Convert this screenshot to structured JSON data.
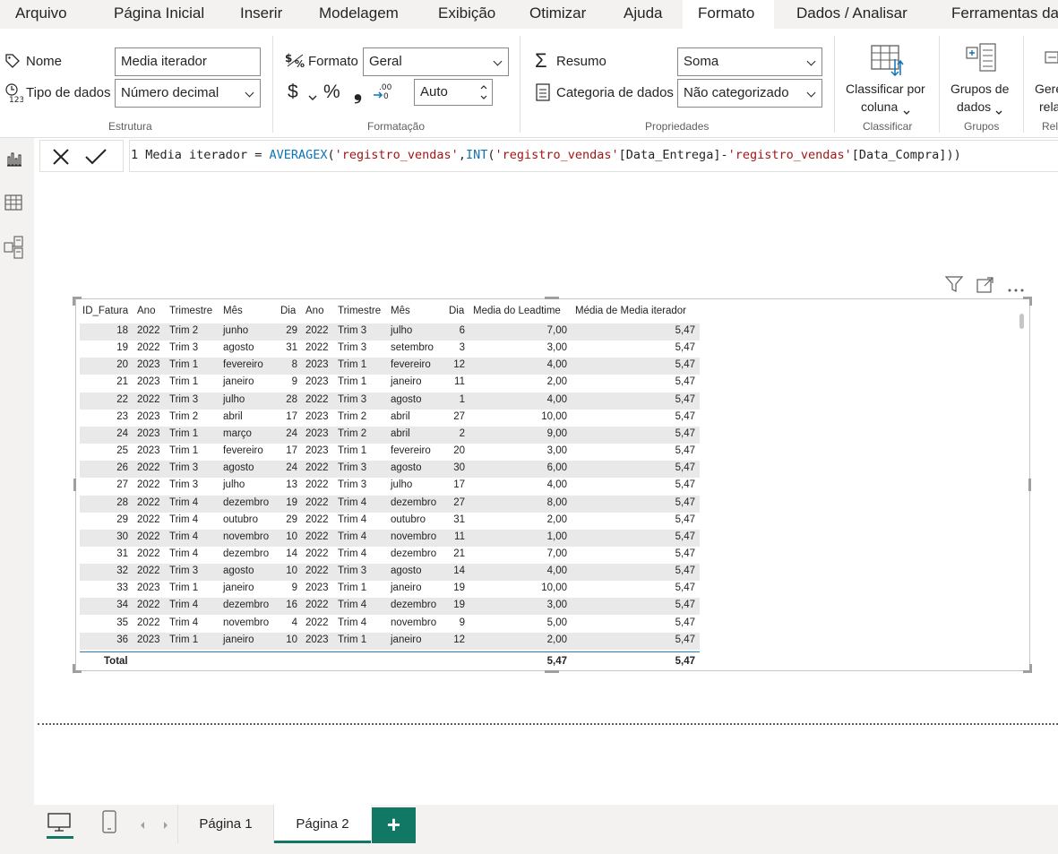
{
  "menu": {
    "tabs": [
      "Arquivo",
      "Página Inicial",
      "Inserir",
      "Modelagem",
      "Exibição",
      "Otimizar",
      "Ajuda",
      "Formato",
      "Dados / Analisar",
      "Ferramentas da"
    ],
    "active": "Formato"
  },
  "ribbon": {
    "estrutura": {
      "nome_label": "Nome",
      "nome_value": "Media iterador",
      "tipo_label": "Tipo de dados",
      "tipo_value": "Número decimal",
      "group_label": "Estrutura"
    },
    "formatacao": {
      "formato_label": "Formato",
      "formato_value": "Geral",
      "currency_symbol": "$",
      "percent_symbol": "%",
      "comma_symbol": "❟",
      "decimals_value": "Auto",
      "group_label": "Formatação"
    },
    "propriedades": {
      "resumo_label": "Resumo",
      "resumo_value": "Soma",
      "categoria_label": "Categoria de dados",
      "categoria_value": "Não categorizado",
      "group_label": "Propriedades"
    },
    "classificar": {
      "button_line1": "Classificar por",
      "button_line2": "coluna",
      "group_label": "Classificar"
    },
    "grupos": {
      "button_line1": "Grupos de",
      "button_line2": "dados",
      "group_label": "Grupos"
    },
    "cut_off": {
      "line1": "Gere",
      "line2": "rela",
      "group_label": "Rela"
    }
  },
  "formula_bar": {
    "line_number": "1",
    "measure_name": "Media iterador",
    "equals": " = ",
    "fn1": "AVERAGEX",
    "open1": "(",
    "table1": "'registro_vendas'",
    "comma": ",",
    "fn2": "INT",
    "open2": "(",
    "table2": "'registro_vendas'",
    "col1": "[Data_Entrega]",
    "minus": "-",
    "table3": "'registro_vendas'",
    "col2": "[Data_Compra]",
    "close": "))"
  },
  "left_rail": {
    "icons": [
      "report-view-icon",
      "data-view-icon",
      "model-view-icon"
    ]
  },
  "table": {
    "headers": [
      "ID_Fatura",
      "Ano",
      "Trimestre",
      "Mês",
      "Dia",
      "Ano",
      "Trimestre",
      "Mês",
      "Dia",
      "Media do Leadtime",
      "Média de Media iterador"
    ],
    "rows": [
      [
        "18",
        "2022",
        "Trim 2",
        "junho",
        "29",
        "2022",
        "Trim 3",
        "julho",
        "6",
        "7,00",
        "5,47"
      ],
      [
        "19",
        "2022",
        "Trim 3",
        "agosto",
        "31",
        "2022",
        "Trim 3",
        "setembro",
        "3",
        "3,00",
        "5,47"
      ],
      [
        "20",
        "2023",
        "Trim 1",
        "fevereiro",
        "8",
        "2023",
        "Trim 1",
        "fevereiro",
        "12",
        "4,00",
        "5,47"
      ],
      [
        "21",
        "2023",
        "Trim 1",
        "janeiro",
        "9",
        "2023",
        "Trim 1",
        "janeiro",
        "11",
        "2,00",
        "5,47"
      ],
      [
        "22",
        "2022",
        "Trim 3",
        "julho",
        "28",
        "2022",
        "Trim 3",
        "agosto",
        "1",
        "4,00",
        "5,47"
      ],
      [
        "23",
        "2023",
        "Trim 2",
        "abril",
        "17",
        "2023",
        "Trim 2",
        "abril",
        "27",
        "10,00",
        "5,47"
      ],
      [
        "24",
        "2023",
        "Trim 1",
        "março",
        "24",
        "2023",
        "Trim 2",
        "abril",
        "2",
        "9,00",
        "5,47"
      ],
      [
        "25",
        "2023",
        "Trim 1",
        "fevereiro",
        "17",
        "2023",
        "Trim 1",
        "fevereiro",
        "20",
        "3,00",
        "5,47"
      ],
      [
        "26",
        "2022",
        "Trim 3",
        "agosto",
        "24",
        "2022",
        "Trim 3",
        "agosto",
        "30",
        "6,00",
        "5,47"
      ],
      [
        "27",
        "2022",
        "Trim 3",
        "julho",
        "13",
        "2022",
        "Trim 3",
        "julho",
        "17",
        "4,00",
        "5,47"
      ],
      [
        "28",
        "2022",
        "Trim 4",
        "dezembro",
        "19",
        "2022",
        "Trim 4",
        "dezembro",
        "27",
        "8,00",
        "5,47"
      ],
      [
        "29",
        "2022",
        "Trim 4",
        "outubro",
        "29",
        "2022",
        "Trim 4",
        "outubro",
        "31",
        "2,00",
        "5,47"
      ],
      [
        "30",
        "2022",
        "Trim 4",
        "novembro",
        "10",
        "2022",
        "Trim 4",
        "novembro",
        "11",
        "1,00",
        "5,47"
      ],
      [
        "31",
        "2022",
        "Trim 4",
        "dezembro",
        "14",
        "2022",
        "Trim 4",
        "dezembro",
        "21",
        "7,00",
        "5,47"
      ],
      [
        "32",
        "2022",
        "Trim 3",
        "agosto",
        "10",
        "2022",
        "Trim 3",
        "agosto",
        "14",
        "4,00",
        "5,47"
      ],
      [
        "33",
        "2023",
        "Trim 1",
        "janeiro",
        "9",
        "2023",
        "Trim 1",
        "janeiro",
        "19",
        "10,00",
        "5,47"
      ],
      [
        "34",
        "2022",
        "Trim 4",
        "dezembro",
        "16",
        "2022",
        "Trim 4",
        "dezembro",
        "19",
        "3,00",
        "5,47"
      ],
      [
        "35",
        "2022",
        "Trim 4",
        "novembro",
        "4",
        "2022",
        "Trim 4",
        "novembro",
        "9",
        "5,00",
        "5,47"
      ],
      [
        "36",
        "2023",
        "Trim 1",
        "janeiro",
        "10",
        "2023",
        "Trim 1",
        "janeiro",
        "12",
        "2,00",
        "5,47"
      ]
    ],
    "total_label": "Total",
    "total_leadtime": "5,47",
    "total_iterador": "5,47"
  },
  "pages": {
    "tabs": [
      "Página 1",
      "Página 2"
    ],
    "active": "Página 2",
    "add_label": "+"
  },
  "colors": {
    "accent_green": "#117865",
    "dax_keyword": "#0e74b8",
    "dax_string": "#a31515"
  }
}
